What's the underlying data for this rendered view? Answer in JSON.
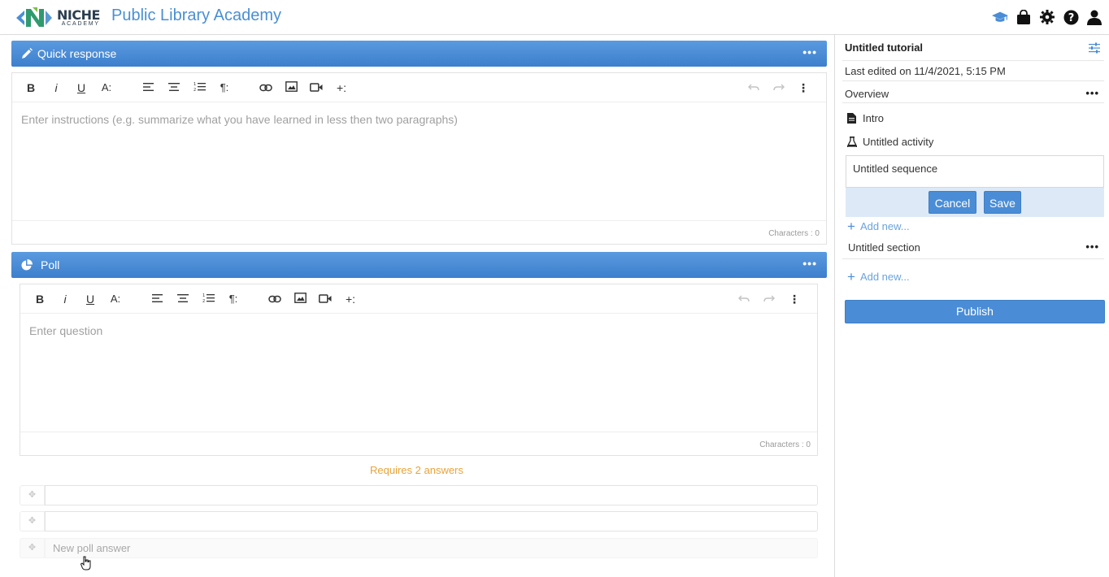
{
  "header": {
    "logo_name": "NICHE",
    "logo_sub": "ACADEMY",
    "app_title": "Public Library Academy",
    "icons": [
      "graduation-cap-icon",
      "shopping-bag-icon",
      "gear-icon",
      "help-icon",
      "user-icon"
    ]
  },
  "blocks": [
    {
      "title": "Quick response",
      "icon": "pencil-icon",
      "more": "•••",
      "placeholder": "Enter instructions (e.g. summarize what you have learned in less then two paragraphs)",
      "characters": "Characters : 0"
    },
    {
      "title": "Poll",
      "icon": "pie-chart-icon",
      "more": "•••",
      "placeholder": "Enter question",
      "characters": "Characters : 0",
      "requires": "Requires 2 answers",
      "answers": [
        "",
        ""
      ],
      "new_answer_placeholder": "New poll answer"
    }
  ],
  "toolbar": {
    "bold": "B",
    "italic": "i",
    "underline": "U",
    "font_size": "A:",
    "paragraph": "¶:",
    "more": "+:",
    "kebab": "⋮"
  },
  "sidebar": {
    "title": "Untitled tutorial",
    "last_edited": "Last edited on 11/4/2021, 5:15 PM",
    "overview_label": "Overview",
    "more": "•••",
    "items": [
      {
        "label": "Intro",
        "icon": "document-icon"
      },
      {
        "label": "Untitled activity",
        "icon": "flask-icon"
      }
    ],
    "sequence_value": "Untitled sequence",
    "cancel_label": "Cancel",
    "save_label": "Save",
    "add_new_label": "Add new...",
    "section_label": "Untitled section",
    "publish_label": "Publish"
  },
  "colors": {
    "accent": "#4a8dd6",
    "title_blue": "#4a8fd4",
    "warning": "#e8a33a"
  }
}
